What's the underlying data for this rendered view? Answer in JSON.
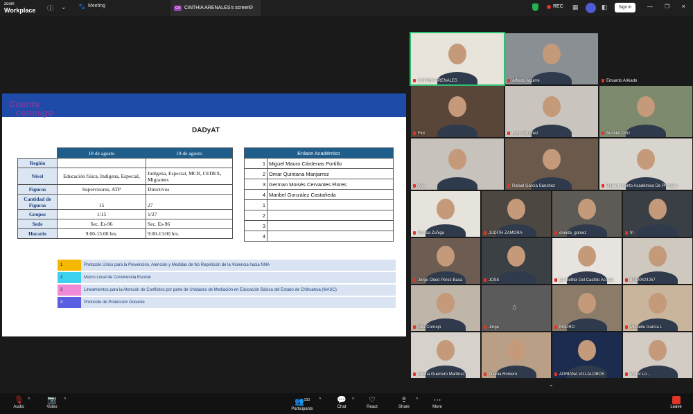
{
  "topbar": {
    "brand_line1": "zoom",
    "brand_line2": "Workplace",
    "meeting_tab": "Meeting",
    "screen_badge": "CA",
    "screen_tab": "CINTHIA ARENALES's screen",
    "rec_label": "REC",
    "signin_label": "Sign in"
  },
  "slide": {
    "logo_line1": "Cuenta",
    "logo_line2": "conmigo",
    "title": "DADyAT",
    "table1": {
      "headers": [
        "18 de agosto",
        "19 de agosto"
      ],
      "rows": [
        {
          "label": "Región",
          "c1": "",
          "c2": ""
        },
        {
          "label": "Nivel",
          "c1": "Educación física, Indígena, Especial,",
          "c2": "Indígena, Especial, MCR, CEDEX, Migrantes"
        },
        {
          "label": "Figuras",
          "c1": "Supervisores, ATP",
          "c2": "Directivos"
        },
        {
          "label": "Cantidad de Figuras",
          "c1": "15",
          "c2": "27"
        },
        {
          "label": "Grupos",
          "c1": "1/15",
          "c2": "1/27"
        },
        {
          "label": "Sede",
          "c1": "Sec. Es-96",
          "c2": "Sec. Es-96"
        },
        {
          "label": "Horario",
          "c1": "9:00-13:00 hrs.",
          "c2": "9:00-13:00 hrs."
        }
      ]
    },
    "table2": {
      "header": "Enlace Académico",
      "rows": [
        {
          "n": "1",
          "name": "Miguel Mauro Cárdenas Portillo"
        },
        {
          "n": "2",
          "name": "Omar Quintana Manjarrez"
        },
        {
          "n": "3",
          "name": "German Moisés Cervantes Flores"
        },
        {
          "n": "4",
          "name": "Maribel González Castañeda"
        },
        {
          "n": "1",
          "name": ""
        },
        {
          "n": "2",
          "name": ""
        },
        {
          "n": "3",
          "name": ""
        },
        {
          "n": "4",
          "name": ""
        }
      ]
    },
    "protocols": [
      {
        "n": "1",
        "text": "Protocolo Único para la Prevención, Atención y Medidas de No Repetición de la Violencia hacia NNA",
        "color": "#f5b800"
      },
      {
        "n": "2",
        "text": "Marco Local de Convivencia Escolar",
        "color": "#3fd1f0"
      },
      {
        "n": "3",
        "text": "Lineamientos para la Atención de Conflictos por parte de Unidades de Mediación en Educación Básica del Estado de Chihuahua (MASC)",
        "color": "#f08ad6"
      },
      {
        "n": "4",
        "text": "Protocolo de Protección Docente",
        "color": "#5a5ee0"
      }
    ]
  },
  "participants_grid": [
    {
      "name": "CINTHIA ARENALES",
      "bg": "#e8e4dc",
      "active": true
    },
    {
      "name": "Alfredo Aguirre",
      "bg": "#8a8f94"
    },
    {
      "name": "Eduardo Arikado",
      "bg": "#1a1a1a",
      "empty": true
    },
    {
      "name": "Flor",
      "bg": "#5a4638"
    },
    {
      "name": "Lucy Sanchez",
      "bg": "#c9c4bd"
    },
    {
      "name": "Sumiko Ortiz",
      "bg": "#7d8a6e"
    },
    {
      "name": "Ana",
      "bg": "#c7c2bb"
    },
    {
      "name": "Rafael García Sánchez",
      "bg": "#6b5a4b"
    },
    {
      "name": "Departamento Académico De Primaria",
      "bg": "#d8d4ce"
    },
    {
      "name": "Marisa Zuñiga",
      "bg": "#e6e2dc"
    },
    {
      "name": "JUDITH ZAMORA",
      "bg": "#4c4741"
    },
    {
      "name": "eneida_gomez",
      "bg": "#5e5a55"
    },
    {
      "name": "frl",
      "bg": "#3a3f45"
    },
    {
      "name": "Jorge Obed Pérez Baca",
      "bg": "#6d5c52"
    },
    {
      "name": "JOSE",
      "bg": "#3b4045"
    },
    {
      "name": "Liz Bethel Del Castillo Acosta",
      "bg": "#e7e3de"
    },
    {
      "name": "87800424257",
      "bg": "#cfc8bf"
    },
    {
      "name": "Gila Cornejo",
      "bg": "#bfb5a8"
    },
    {
      "name": "Jorge",
      "bg": "#5b5b5b",
      "placeholder": true
    },
    {
      "name": "MAURO",
      "bg": "#8b7c6a"
    },
    {
      "name": "Michelle García L",
      "bg": "#c8b59c"
    },
    {
      "name": "Liliana Guerrero Martinez",
      "bg": "#d6d1cb"
    },
    {
      "name": "Thania Romero",
      "bg": "#b89f86"
    },
    {
      "name": "ADRIANA VILLALOBOS",
      "bg": "#1b2c4f"
    },
    {
      "name": "Víctor Lo...",
      "bg": "#d2ccc4"
    }
  ],
  "bottombar": {
    "audio": "Audio",
    "video": "Video",
    "participants": "Participants",
    "participants_count": "103",
    "chat": "Chat",
    "react": "React",
    "share": "Share",
    "more": "More",
    "leave": "Leave"
  }
}
